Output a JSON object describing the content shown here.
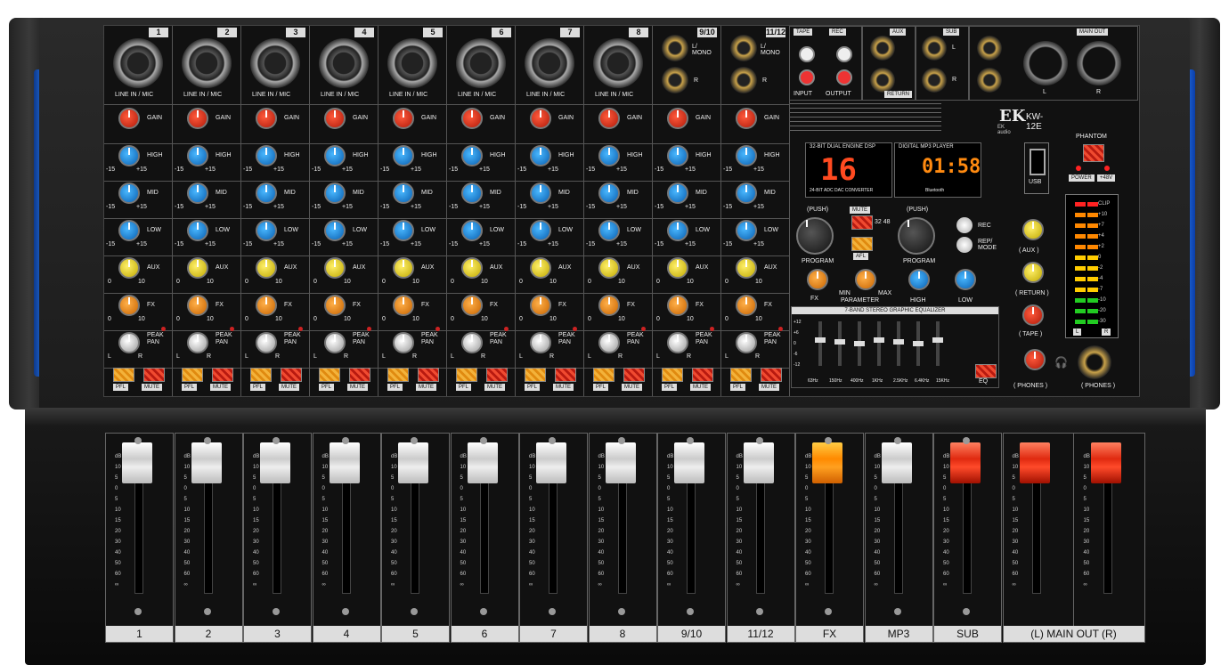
{
  "brand": {
    "logo": "EK",
    "sub": "EK audio",
    "model": "KW-12E"
  },
  "mono_channels": [
    {
      "num": "1",
      "jack_label": "LINE IN / MIC"
    },
    {
      "num": "2",
      "jack_label": "LINE IN / MIC"
    },
    {
      "num": "3",
      "jack_label": "LINE IN / MIC"
    },
    {
      "num": "4",
      "jack_label": "LINE IN / MIC"
    },
    {
      "num": "5",
      "jack_label": "LINE IN / MIC"
    },
    {
      "num": "6",
      "jack_label": "LINE IN / MIC"
    },
    {
      "num": "7",
      "jack_label": "LINE IN / MIC"
    },
    {
      "num": "8",
      "jack_label": "LINE IN / MIC"
    }
  ],
  "stereo_channels": [
    {
      "num": "9/10",
      "l": "L/ MONO",
      "r": "R"
    },
    {
      "num": "11/12",
      "l": "L/ MONO",
      "r": "R"
    }
  ],
  "strip_labels": {
    "gain": "GAIN",
    "high": "HIGH",
    "mid": "MID",
    "low": "LOW",
    "aux": "AUX",
    "fx": "FX",
    "pan": "PAN",
    "peak": "PEAK",
    "pfl": "PFL",
    "mute": "MUTE",
    "plus15": "+15",
    "minus15": "-15",
    "zero": "0",
    "ten": "10",
    "l": "L",
    "r": "R"
  },
  "io": {
    "tape": "TAPE",
    "rec": "REC",
    "input": "INPUT",
    "output": "OUTPUT",
    "aux": "AUX",
    "return": "RETURN",
    "sub": "SUB",
    "main_out": "MAIN OUT",
    "l": "L",
    "r": "R"
  },
  "dsp": {
    "title": "32-BIT DUAL ENGINE DSP",
    "number": "16",
    "converter": "24-BIT ADC DAC CONVERTER",
    "push": "(PUSH)",
    "mute": "MUTE",
    "afl": "AFL",
    "program": "PROGRAM",
    "parameter": "PARAMETER",
    "fx": "FX",
    "min": "MIN",
    "max": "MAX",
    "badge": "32 48"
  },
  "mp3": {
    "title": "DIGITAL MP3 PLAYER",
    "time": "01:58",
    "bluetooth": "Bluetooth",
    "usb": "USB",
    "push": "(PUSH)",
    "rec": "REC",
    "rep_mode": "REP/ MODE",
    "program": "PROGRAM",
    "high": "HIGH",
    "low": "LOW"
  },
  "phantom": {
    "title": "PHANTOM",
    "power": "POWER",
    "v48": "+48V"
  },
  "meter": {
    "labels": [
      "CLIP",
      "+10",
      "+7",
      "+4",
      "+2",
      "0",
      "-2",
      "-4",
      "-7",
      "-10",
      "-20",
      "-30"
    ],
    "l": "L",
    "r": "R"
  },
  "right_knobs": {
    "aux": "( AUX )",
    "return": "( RETURN )",
    "tape": "( TAPE )",
    "phones": "( PHONES )",
    "phones_jack": "( PHONES )",
    "max": "MAX",
    "zero": "0",
    "ten": "10"
  },
  "geq": {
    "title": "7-BAND STEREO GRAPHIC EQUALIZER",
    "bands": [
      "63Hz",
      "150Hz",
      "400Hz",
      "1KHz",
      "2.5KHz",
      "6.4KHz",
      "15KHz"
    ],
    "eq": "EQ",
    "scale": [
      "+12",
      "+6",
      "0",
      "-6",
      "-12"
    ]
  },
  "faders": {
    "scale": [
      "dB",
      "10",
      "5",
      "0",
      "5",
      "10",
      "15",
      "20",
      "30",
      "40",
      "50",
      "60",
      "∞"
    ],
    "items": [
      {
        "label": "1",
        "cap": "white"
      },
      {
        "label": "2",
        "cap": "white"
      },
      {
        "label": "3",
        "cap": "white"
      },
      {
        "label": "4",
        "cap": "white"
      },
      {
        "label": "5",
        "cap": "white"
      },
      {
        "label": "6",
        "cap": "white"
      },
      {
        "label": "7",
        "cap": "white"
      },
      {
        "label": "8",
        "cap": "white"
      },
      {
        "label": "9/10",
        "cap": "white"
      },
      {
        "label": "11/12",
        "cap": "white"
      },
      {
        "label": "FX",
        "cap": "orange"
      },
      {
        "label": "MP3",
        "cap": "white"
      },
      {
        "label": "SUB",
        "cap": "red"
      }
    ],
    "main": {
      "label": "(L)  MAIN OUT  (R)",
      "cap": "red"
    }
  }
}
